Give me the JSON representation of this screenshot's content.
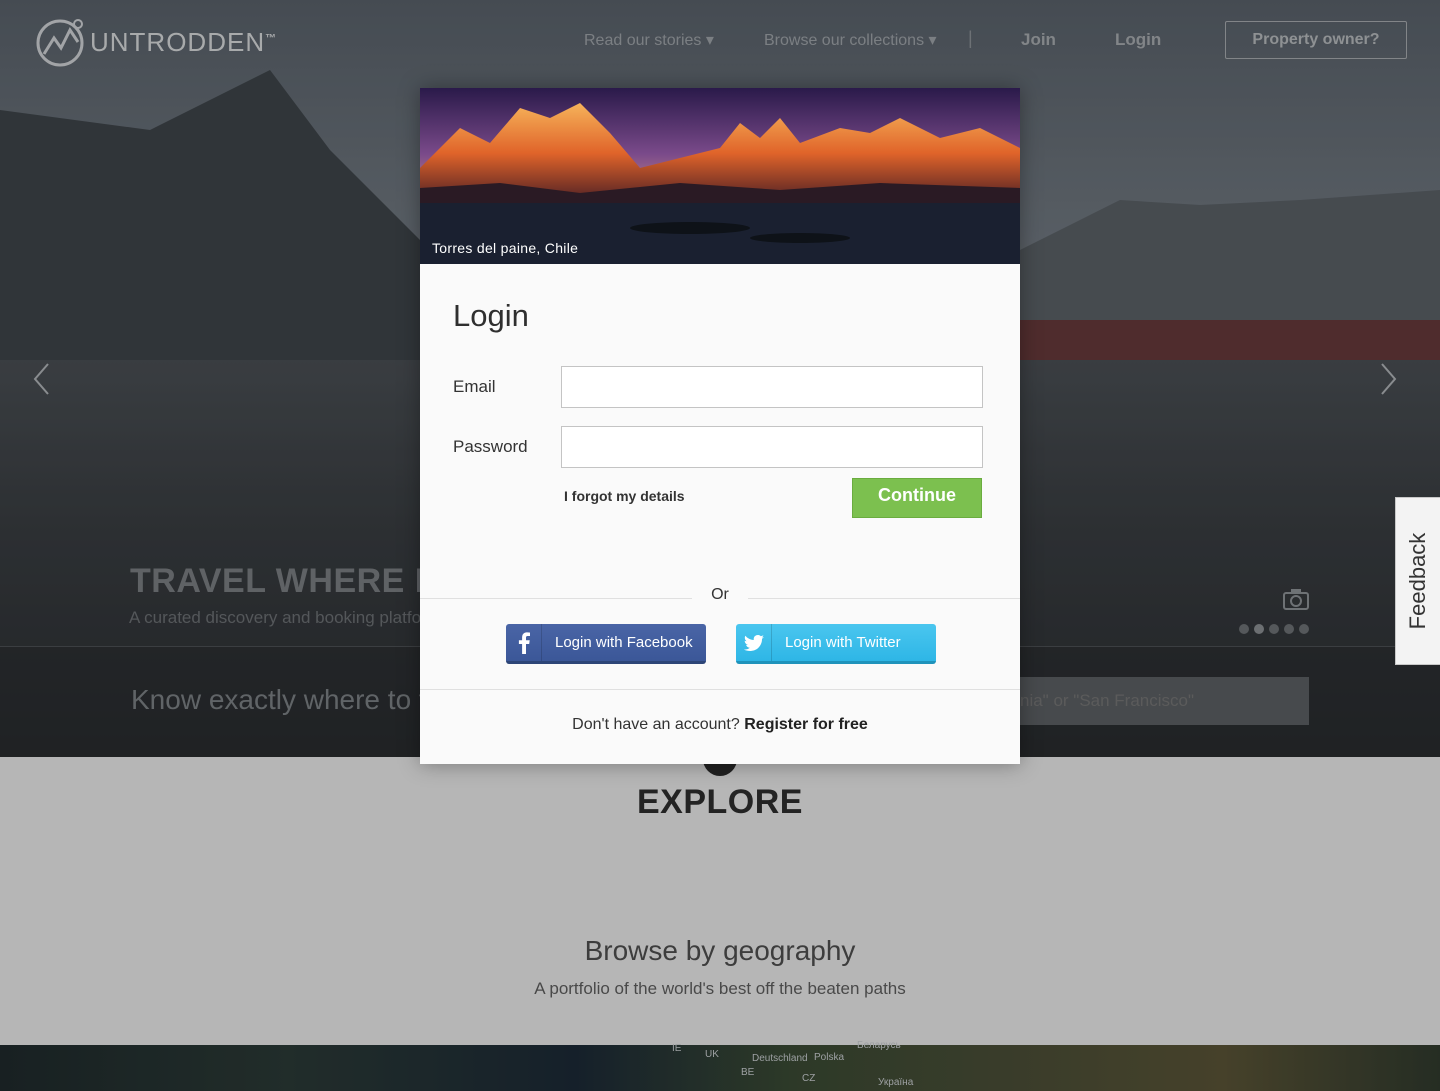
{
  "brand": {
    "name": "UNTRODDEN",
    "tm": "™"
  },
  "nav": {
    "stories": "Read our stories",
    "collections": "Browse our collections",
    "separator": "|",
    "join": "Join",
    "login": "Login",
    "owner": "Property owner?"
  },
  "hero": {
    "headline": "TRAVEL WHERE IT",
    "subline": "A curated discovery and booking platfo",
    "search_prompt": "Know exactly where to tr",
    "search_placeholder": "nia\" or \"San Francisco\"",
    "slide_dots": 5,
    "active_slide": 2
  },
  "sections": {
    "explore": "EXPLORE",
    "geo_title": "Browse by geography",
    "geo_sub": "A portfolio of the world's best off the beaten paths"
  },
  "map_labels": [
    "IE",
    "UK",
    "Deutschland",
    "Polska",
    "Беларусь",
    "BE",
    "CZ",
    "Україна"
  ],
  "feedback": "Feedback",
  "modal": {
    "photo_caption": "Torres del paine, Chile",
    "title": "Login",
    "email_label": "Email",
    "password_label": "Password",
    "email_value": "",
    "password_value": "",
    "forgot": "I forgot my details",
    "continue": "Continue",
    "or": "Or",
    "facebook": "Login with Facebook",
    "twitter": "Login with Twitter",
    "no_account": "Don't have an account?",
    "register": "Register for free"
  },
  "colors": {
    "continue": "#7cc04f",
    "facebook": "#3b5798",
    "twitter": "#2eb6e6"
  }
}
